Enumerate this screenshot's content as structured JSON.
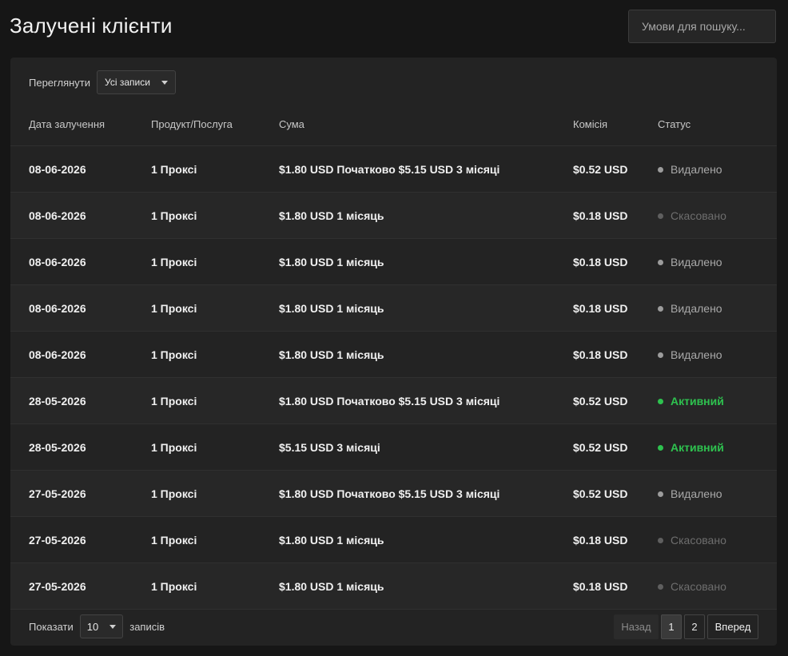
{
  "header": {
    "title": "Залучені клієнти",
    "search_placeholder": "Умови для пошуку..."
  },
  "filter": {
    "label": "Переглянути",
    "selected": "Усі записи"
  },
  "table": {
    "columns": [
      "Дата залучення",
      "Продукт/Послуга",
      "Сума",
      "Комісія",
      "Статус"
    ],
    "rows": [
      {
        "date": "08-06-2026",
        "product": "1 Проксі",
        "amount": "$1.80 USD Початково $5.15 USD 3 місяці",
        "commission": "$0.52 USD",
        "status": "Видалено",
        "status_type": "removed"
      },
      {
        "date": "08-06-2026",
        "product": "1 Проксі",
        "amount": "$1.80 USD 1 місяць",
        "commission": "$0.18 USD",
        "status": "Скасовано",
        "status_type": "cancelled"
      },
      {
        "date": "08-06-2026",
        "product": "1 Проксі",
        "amount": "$1.80 USD 1 місяць",
        "commission": "$0.18 USD",
        "status": "Видалено",
        "status_type": "removed"
      },
      {
        "date": "08-06-2026",
        "product": "1 Проксі",
        "amount": "$1.80 USD 1 місяць",
        "commission": "$0.18 USD",
        "status": "Видалено",
        "status_type": "removed"
      },
      {
        "date": "08-06-2026",
        "product": "1 Проксі",
        "amount": "$1.80 USD 1 місяць",
        "commission": "$0.18 USD",
        "status": "Видалено",
        "status_type": "removed"
      },
      {
        "date": "28-05-2026",
        "product": "1 Проксі",
        "amount": "$1.80 USD Початково $5.15 USD 3 місяці",
        "commission": "$0.52 USD",
        "status": "Активний",
        "status_type": "active"
      },
      {
        "date": "28-05-2026",
        "product": "1 Проксі",
        "amount": "$5.15 USD 3 місяці",
        "commission": "$0.52 USD",
        "status": "Активний",
        "status_type": "active"
      },
      {
        "date": "27-05-2026",
        "product": "1 Проксі",
        "amount": "$1.80 USD Початково $5.15 USD 3 місяці",
        "commission": "$0.52 USD",
        "status": "Видалено",
        "status_type": "removed"
      },
      {
        "date": "27-05-2026",
        "product": "1 Проксі",
        "amount": "$1.80 USD 1 місяць",
        "commission": "$0.18 USD",
        "status": "Скасовано",
        "status_type": "cancelled"
      },
      {
        "date": "27-05-2026",
        "product": "1 Проксі",
        "amount": "$1.80 USD 1 місяць",
        "commission": "$0.18 USD",
        "status": "Скасовано",
        "status_type": "cancelled"
      }
    ]
  },
  "footer": {
    "show_label": "Показати",
    "page_length": "10",
    "records_label": "записів"
  },
  "pagination": {
    "prev_label": "Назад",
    "pages": [
      "1",
      "2"
    ],
    "current_page": "1",
    "next_label": "Вперед"
  },
  "colors": {
    "background": "#161616",
    "card": "#232323",
    "active_status": "#2ec24f",
    "removed_status": "#a9a9a9",
    "cancelled_status": "#6e6e6e"
  }
}
